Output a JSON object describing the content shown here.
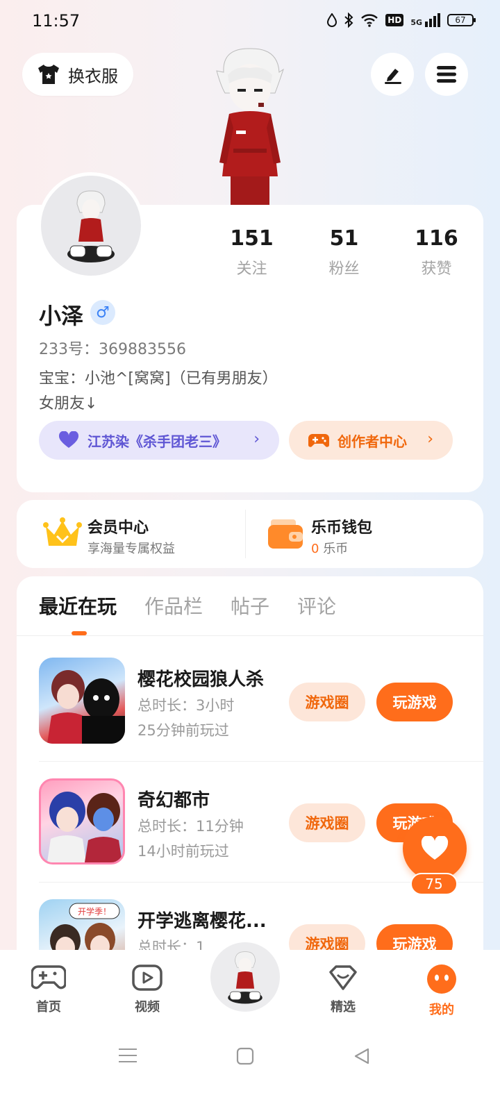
{
  "status_bar": {
    "time": "11:57",
    "hd": "HD",
    "network": "5G",
    "battery": "67"
  },
  "header": {
    "change_outfit_label": "换衣服",
    "edit_icon": "edit-icon",
    "menu_icon": "menu-icon"
  },
  "profile": {
    "stats": [
      {
        "value": "151",
        "label": "关注"
      },
      {
        "value": "51",
        "label": "粉丝"
      },
      {
        "value": "116",
        "label": "获赞"
      }
    ],
    "username": "小泽",
    "gender_symbol": "♂",
    "id_text": "233号：369883556",
    "bio_line1": "宝宝：小池^[窝窝]（已有男朋友）",
    "bio_line2": "女朋友↓",
    "tag_purple": "江苏染《杀手团老三》",
    "tag_orange": "创作者中心"
  },
  "member": {
    "vip_title": "会员中心",
    "vip_sub": "享海量专属权益",
    "wallet_title": "乐币钱包",
    "wallet_amount": "0",
    "wallet_unit": "乐币"
  },
  "tabs": [
    "最近在玩",
    "作品栏",
    "帖子",
    "评论"
  ],
  "games": [
    {
      "name": "樱花校园狼人杀",
      "duration": "总时长：3小时",
      "last_played": "25分钟前玩过"
    },
    {
      "name": "奇幻都市",
      "duration": "总时长：11分钟",
      "last_played": "14小时前玩过"
    },
    {
      "name": "开学逃离樱花...",
      "duration": "总时长：1...",
      "last_played": ""
    }
  ],
  "game_buttons": {
    "circle": "游戏圈",
    "play": "玩游戏"
  },
  "thumb3_banner": "开学季！",
  "float_like": {
    "count": "75"
  },
  "bottom_nav": [
    "首页",
    "视频",
    "精选",
    "我的"
  ],
  "colors": {
    "accent": "#ff6d1b",
    "purple": "#5f56d4"
  }
}
